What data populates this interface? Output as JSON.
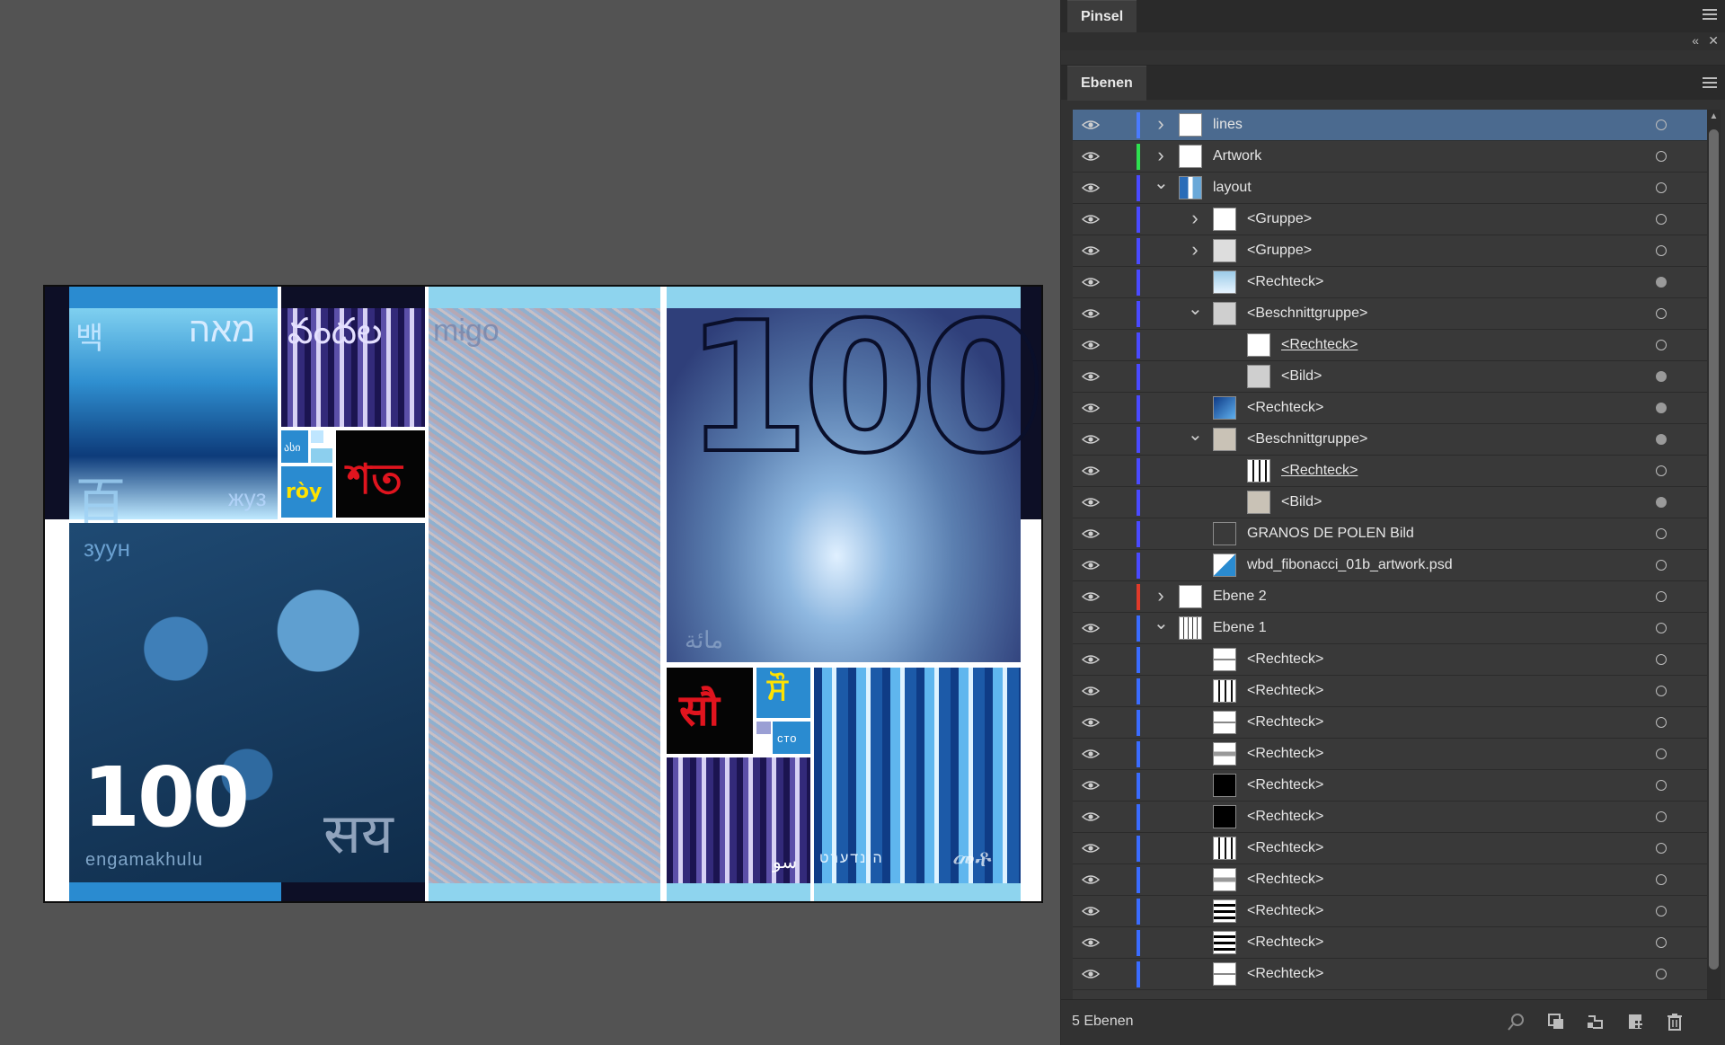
{
  "panels": {
    "brush_tab": "Pinsel",
    "layers_tab": "Ebenen",
    "collapse_icon": "double-chevron-left-icon",
    "close_icon": "close-icon",
    "menu_icon": "panel-menu-icon",
    "status": "5 Ebenen",
    "footer_icons": [
      "search-icon",
      "collect-for-export-icon",
      "create-clipping-mask-icon",
      "new-sublayer-icon",
      "new-layer-icon",
      "delete-icon"
    ]
  },
  "layers": [
    {
      "name": "lines",
      "color": "#4a7bff",
      "depth": 0,
      "expand": "collapsed",
      "thumb": "white",
      "selected": true,
      "target": "empty"
    },
    {
      "name": "Artwork",
      "color": "#2ee050",
      "depth": 0,
      "expand": "collapsed",
      "thumb": "artwork",
      "target": "empty"
    },
    {
      "name": "layout",
      "color": "#4a4aff",
      "depth": 0,
      "expand": "expanded",
      "thumb": "layout",
      "target": "empty"
    },
    {
      "name": "<Gruppe>",
      "color": "#4a4aff",
      "depth": 1,
      "expand": "collapsed",
      "thumb": "white",
      "target": "empty"
    },
    {
      "name": "<Gruppe>",
      "color": "#4a4aff",
      "depth": 1,
      "expand": "collapsed",
      "thumb": "hundred",
      "target": "empty"
    },
    {
      "name": "<Rechteck>",
      "color": "#4a4aff",
      "depth": 1,
      "expand": "none",
      "thumb": "lightblue",
      "target": "filled"
    },
    {
      "name": "<Beschnittgruppe>",
      "color": "#4a4aff",
      "depth": 1,
      "expand": "expanded",
      "thumb": "grey",
      "target": "empty"
    },
    {
      "name": "<Rechteck>",
      "color": "#4a4aff",
      "depth": 2,
      "expand": "none",
      "thumb": "white",
      "underline": true,
      "target": "empty"
    },
    {
      "name": "<Bild>",
      "color": "#4a4aff",
      "depth": 2,
      "expand": "none",
      "thumb": "grey",
      "target": "filled"
    },
    {
      "name": "<Rechteck>",
      "color": "#4a4aff",
      "depth": 1,
      "expand": "none",
      "thumb": "blue",
      "target": "filled"
    },
    {
      "name": "<Beschnittgruppe>",
      "color": "#4a4aff",
      "depth": 1,
      "expand": "expanded",
      "thumb": "tan",
      "target": "filled"
    },
    {
      "name": "<Rechteck>",
      "color": "#4a4aff",
      "depth": 2,
      "expand": "none",
      "thumb": "bars",
      "underline": true,
      "target": "empty"
    },
    {
      "name": "<Bild>",
      "color": "#4a4aff",
      "depth": 2,
      "expand": "none",
      "thumb": "tan",
      "target": "filled"
    },
    {
      "name": "GRANOS DE POLEN Bild",
      "color": "#4a4aff",
      "depth": 1,
      "expand": "none",
      "thumb": "dark",
      "target": "empty"
    },
    {
      "name": "wbd_fibonacci_01b_artwork.psd",
      "color": "#4a4aff",
      "depth": 1,
      "expand": "none",
      "thumb": "psd",
      "target": "empty"
    },
    {
      "name": "Ebene 2",
      "color": "#e03a2a",
      "depth": 0,
      "expand": "collapsed",
      "thumb": "white",
      "target": "empty"
    },
    {
      "name": "Ebene 1",
      "color": "#3a6cff",
      "depth": 0,
      "expand": "expanded",
      "thumb": "lines",
      "target": "empty"
    },
    {
      "name": "<Rechteck>",
      "color": "#3a6cff",
      "depth": 1,
      "expand": "none",
      "thumb": "hline",
      "target": "empty"
    },
    {
      "name": "<Rechteck>",
      "color": "#3a6cff",
      "depth": 1,
      "expand": "none",
      "thumb": "bars",
      "target": "empty"
    },
    {
      "name": "<Rechteck>",
      "color": "#3a6cff",
      "depth": 1,
      "expand": "none",
      "thumb": "hline",
      "target": "empty"
    },
    {
      "name": "<Rechteck>",
      "color": "#3a6cff",
      "depth": 1,
      "expand": "none",
      "thumb": "hgrey",
      "target": "empty"
    },
    {
      "name": "<Rechteck>",
      "color": "#3a6cff",
      "depth": 1,
      "expand": "none",
      "thumb": "black",
      "target": "empty"
    },
    {
      "name": "<Rechteck>",
      "color": "#3a6cff",
      "depth": 1,
      "expand": "none",
      "thumb": "black",
      "target": "empty"
    },
    {
      "name": "<Rechteck>",
      "color": "#3a6cff",
      "depth": 1,
      "expand": "none",
      "thumb": "bars",
      "target": "empty"
    },
    {
      "name": "<Rechteck>",
      "color": "#3a6cff",
      "depth": 1,
      "expand": "none",
      "thumb": "hgrey",
      "target": "empty"
    },
    {
      "name": "<Rechteck>",
      "color": "#3a6cff",
      "depth": 1,
      "expand": "none",
      "thumb": "hbars",
      "target": "empty"
    },
    {
      "name": "<Rechteck>",
      "color": "#3a6cff",
      "depth": 1,
      "expand": "none",
      "thumb": "hbars",
      "target": "empty"
    },
    {
      "name": "<Rechteck>",
      "color": "#3a6cff",
      "depth": 1,
      "expand": "none",
      "thumb": "hline",
      "target": "empty"
    }
  ],
  "artwork": {
    "text_korean": "백",
    "text_hebrew_top": "מאה",
    "text_telugu": "వందల",
    "text_chinese": "百",
    "text_mongolian_small": "жуз",
    "text_georgian_small": "ასი",
    "text_vietnamese": "ròy",
    "text_bengali": "শত",
    "text_mongolian": "зуун",
    "text_hundred_left": "100",
    "text_nepali": "सय",
    "text_zulu": "engamakhulu",
    "text_map_top": "mɨɡo",
    "text_hundred_big": "100",
    "text_arabic": "مائة",
    "text_hindi": "सौ",
    "text_punjabi": "ਸੌ",
    "text_russian": "сто",
    "text_urdu": "سو",
    "text_yiddish": "הונדערט",
    "text_amharic": "መቶ"
  }
}
